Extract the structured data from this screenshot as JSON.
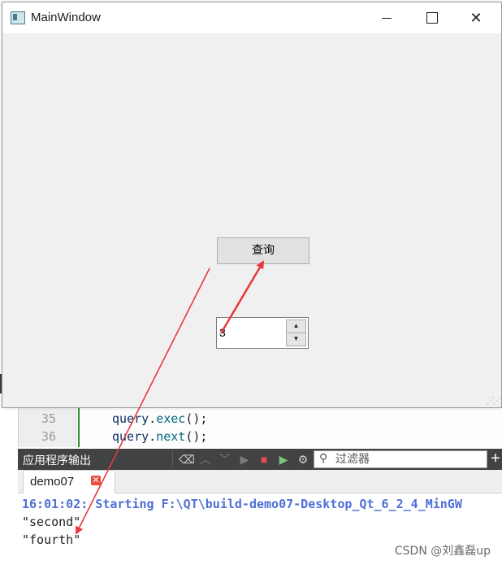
{
  "window": {
    "title": "MainWindow",
    "minimize_icon": "minimize-icon",
    "maximize_icon": "maximize-icon",
    "close_icon": "close-icon"
  },
  "form": {
    "query_button_label": "查询",
    "spinbox_value": "3"
  },
  "editor": {
    "lines": [
      {
        "number": "35",
        "obj": "query",
        "dot": ".",
        "fn": "exec",
        "rest": "();"
      },
      {
        "number": "36",
        "obj": "query",
        "dot": ".",
        "fn": "next",
        "rest": "();"
      }
    ]
  },
  "output_pane": {
    "title": "应用程序输出",
    "filter_placeholder": "过滤器",
    "tab_label": "demo07",
    "lines": [
      "16:01:02: Starting F:\\QT\\build-demo07-Desktop_Qt_6_2_4_MinGW",
      "\"second\"",
      "\"fourth\""
    ]
  },
  "watermark": "CSDN @刘鑫磊up",
  "colors": {
    "annotation_arrow": "#e8383d",
    "starting_text": "#4e6fd8",
    "toolbar_bg": "#404244"
  }
}
